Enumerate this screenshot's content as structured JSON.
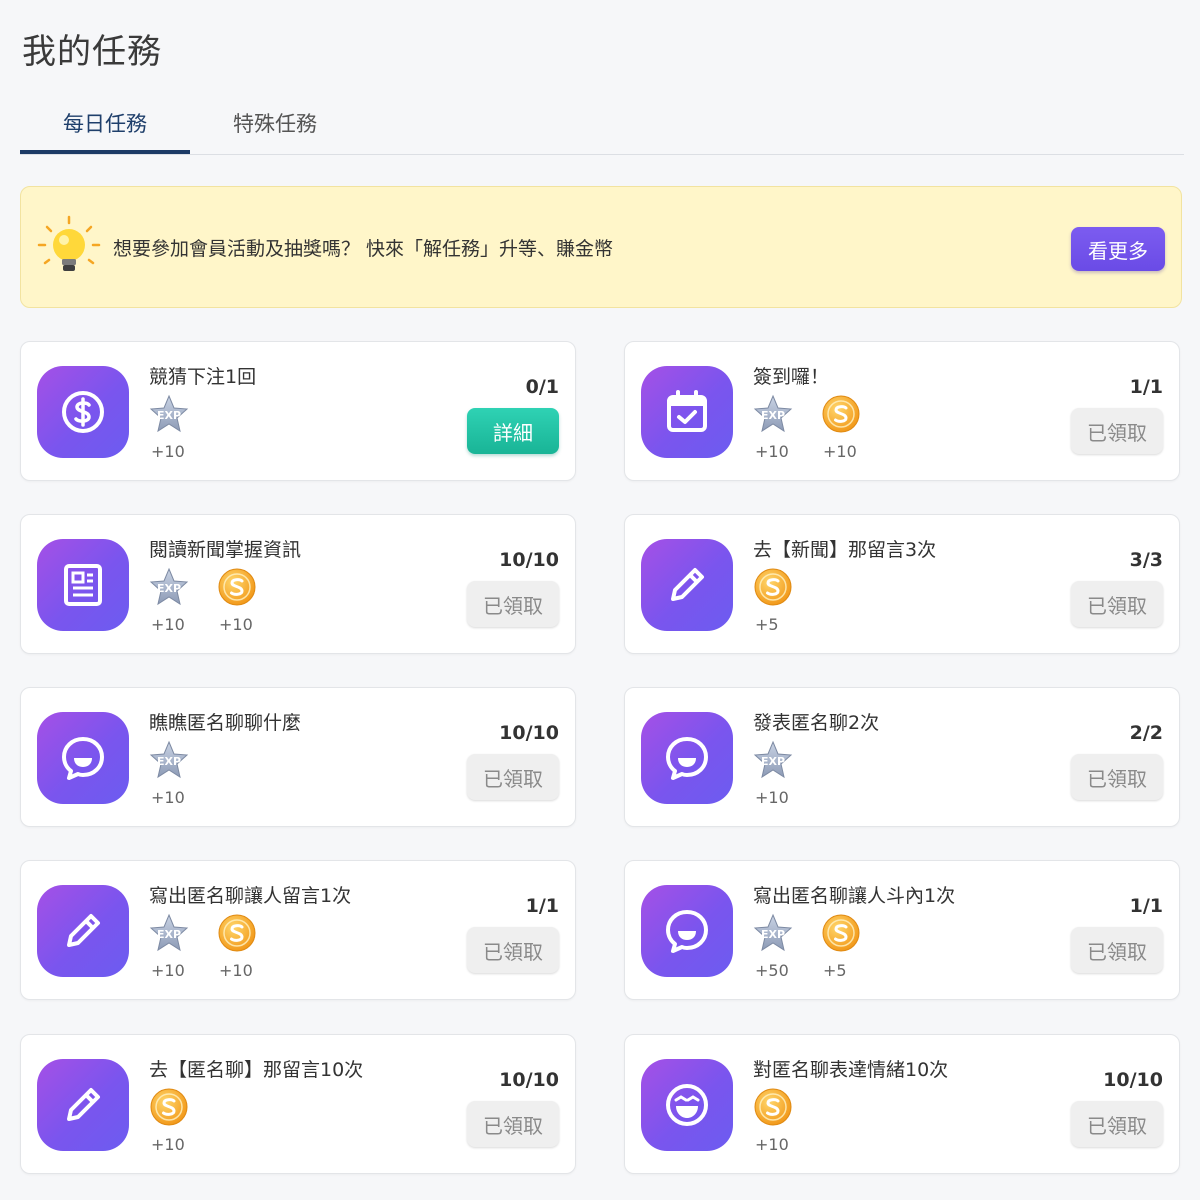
{
  "page": {
    "title": "我的任務"
  },
  "tabs": [
    {
      "label": "每日任務"
    },
    {
      "label": "特殊任務"
    }
  ],
  "banner": {
    "text": "想要參加會員活動及抽獎嗎？ 快來「解任務」升等、賺金幣",
    "button": "看更多"
  },
  "colors": {
    "accent": "#1c3b66",
    "icon_gradient_start": "#a550e6",
    "icon_gradient_end": "#6c5cf0",
    "detail_button": "#19b496",
    "banner_bg": "#fff6c9"
  },
  "tasks": [
    {
      "name": "競猜下注1回",
      "icon": "dollar-icon",
      "progress": "0/1",
      "action": "詳細",
      "rewards": [
        {
          "type": "exp",
          "amount": "+10"
        }
      ]
    },
    {
      "name": "簽到囉！",
      "icon": "calendar-check-icon",
      "progress": "1/1",
      "action": "已領取",
      "rewards": [
        {
          "type": "exp",
          "amount": "+10"
        },
        {
          "type": "coin",
          "amount": "+10"
        }
      ]
    },
    {
      "name": "閱讀新聞掌握資訊",
      "icon": "newspaper-icon",
      "progress": "10/10",
      "action": "已領取",
      "rewards": [
        {
          "type": "exp",
          "amount": "+10"
        },
        {
          "type": "coin",
          "amount": "+10"
        }
      ]
    },
    {
      "name": "去【新聞】那留言3次",
      "icon": "pencil-icon",
      "progress": "3/3",
      "action": "已領取",
      "rewards": [
        {
          "type": "coin",
          "amount": "+5"
        }
      ]
    },
    {
      "name": "瞧瞧匿名聊聊什麼",
      "icon": "chat-smile-icon",
      "progress": "10/10",
      "action": "已領取",
      "rewards": [
        {
          "type": "exp",
          "amount": "+10"
        }
      ]
    },
    {
      "name": "發表匿名聊2次",
      "icon": "chat-smile-icon",
      "progress": "2/2",
      "action": "已領取",
      "rewards": [
        {
          "type": "exp",
          "amount": "+10"
        }
      ]
    },
    {
      "name": "寫出匿名聊讓人留言1次",
      "icon": "pencil-icon",
      "progress": "1/1",
      "action": "已領取",
      "rewards": [
        {
          "type": "exp",
          "amount": "+10"
        },
        {
          "type": "coin",
          "amount": "+10"
        }
      ]
    },
    {
      "name": "寫出匿名聊讓人斗內1次",
      "icon": "chat-smile-icon",
      "progress": "1/1",
      "action": "已領取",
      "rewards": [
        {
          "type": "exp",
          "amount": "+50"
        },
        {
          "type": "coin",
          "amount": "+5"
        }
      ]
    },
    {
      "name": "去【匿名聊】那留言10次",
      "icon": "pencil-icon",
      "progress": "10/10",
      "action": "已領取",
      "rewards": [
        {
          "type": "coin",
          "amount": "+10"
        }
      ]
    },
    {
      "name": "對匿名聊表達情緒10次",
      "icon": "laugh-icon",
      "progress": "10/10",
      "action": "已領取",
      "rewards": [
        {
          "type": "coin",
          "amount": "+10"
        }
      ]
    }
  ]
}
